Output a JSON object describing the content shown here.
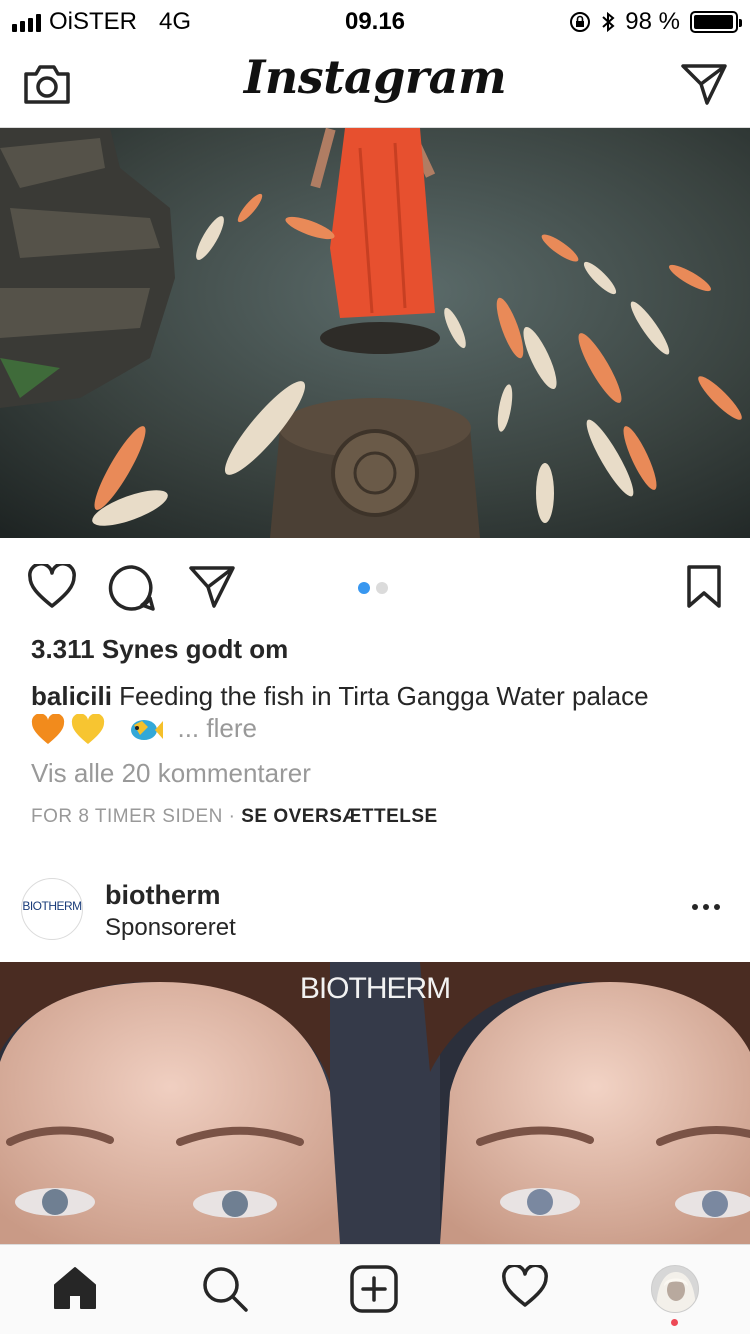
{
  "status_bar": {
    "carrier": "OiSTER",
    "network": "4G",
    "time": "09.16",
    "battery": "98 %",
    "battery_level": 0.98
  },
  "header": {
    "logo": "Instagram",
    "left_icon": "camera-icon",
    "right_icon": "direct-message-icon"
  },
  "post1": {
    "carousel_pages": 2,
    "carousel_active": 1,
    "likes": "3.311 Synes godt om",
    "username": "balicili",
    "caption": "Feeding the fish in Tirta Gangga Water palace",
    "emojis": [
      "orange-heart-emoji",
      "yellow-heart-emoji",
      "tropical-fish-emoji"
    ],
    "more": "... flere",
    "comments_link": "Vis alle 20 kommentarer",
    "timestamp": "FOR 8 TIMER SIDEN",
    "separator": "·",
    "translate": "SE OVERSÆTTELSE"
  },
  "post2": {
    "username": "biotherm",
    "subtitle": "Sponsoreret",
    "avatar_text": "BIOTHERM",
    "image_brand": "BIOTHERM"
  },
  "tabbar": {
    "tabs": [
      "home-icon",
      "search-icon",
      "new-post-icon",
      "activity-icon",
      "profile-avatar"
    ]
  },
  "colors": {
    "accent": "#3897f0",
    "text": "#262626",
    "muted": "#999999",
    "notification": "#ed4956"
  }
}
